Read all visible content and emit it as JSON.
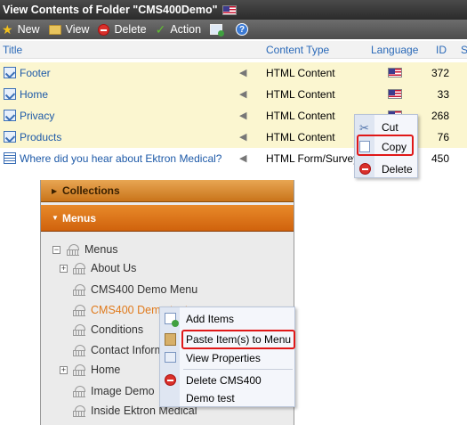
{
  "titlebar": {
    "title": "View Contents of Folder \"CMS400Demo\""
  },
  "toolbar": {
    "new_label": "New",
    "view_label": "View",
    "delete_label": "Delete",
    "action_label": "Action"
  },
  "list": {
    "columns": {
      "title": "Title",
      "content_type": "Content Type",
      "language": "Language",
      "id": "ID",
      "status": "S"
    },
    "rows": [
      {
        "title": "Footer",
        "content_type": "HTML Content",
        "id": "372"
      },
      {
        "title": "Home",
        "content_type": "HTML Content",
        "id": "33"
      },
      {
        "title": "Privacy",
        "content_type": "HTML Content",
        "id": "268"
      },
      {
        "title": "Products",
        "content_type": "HTML Content",
        "id": "76"
      },
      {
        "title": "Where did you hear about Ektron Medical?",
        "content_type": "HTML Form/Survey",
        "id": "450"
      }
    ]
  },
  "context_menu_1": {
    "cut": "Cut",
    "copy": "Copy",
    "delete": "Delete"
  },
  "sidebar": {
    "collections_label": "Collections",
    "menus_label": "Menus",
    "tree": {
      "root": "Menus",
      "items": [
        "About Us",
        "CMS400 Demo Menu",
        "CMS400 Demo test",
        "Conditions",
        "Contact Information",
        "Home",
        "Image Demo",
        "Inside Ektron Medical"
      ]
    }
  },
  "context_menu_2": {
    "add_items": "Add Items",
    "paste": "Paste Item(s) to Menu",
    "view_properties": "View Properties",
    "delete": "Delete CMS400",
    "demo_test": "Demo test"
  },
  "colors": {
    "accent_orange": "#d0620d",
    "highlight_red": "#e01818",
    "row_yellow": "#fbf6d0",
    "link_blue": "#1e5aa8"
  }
}
